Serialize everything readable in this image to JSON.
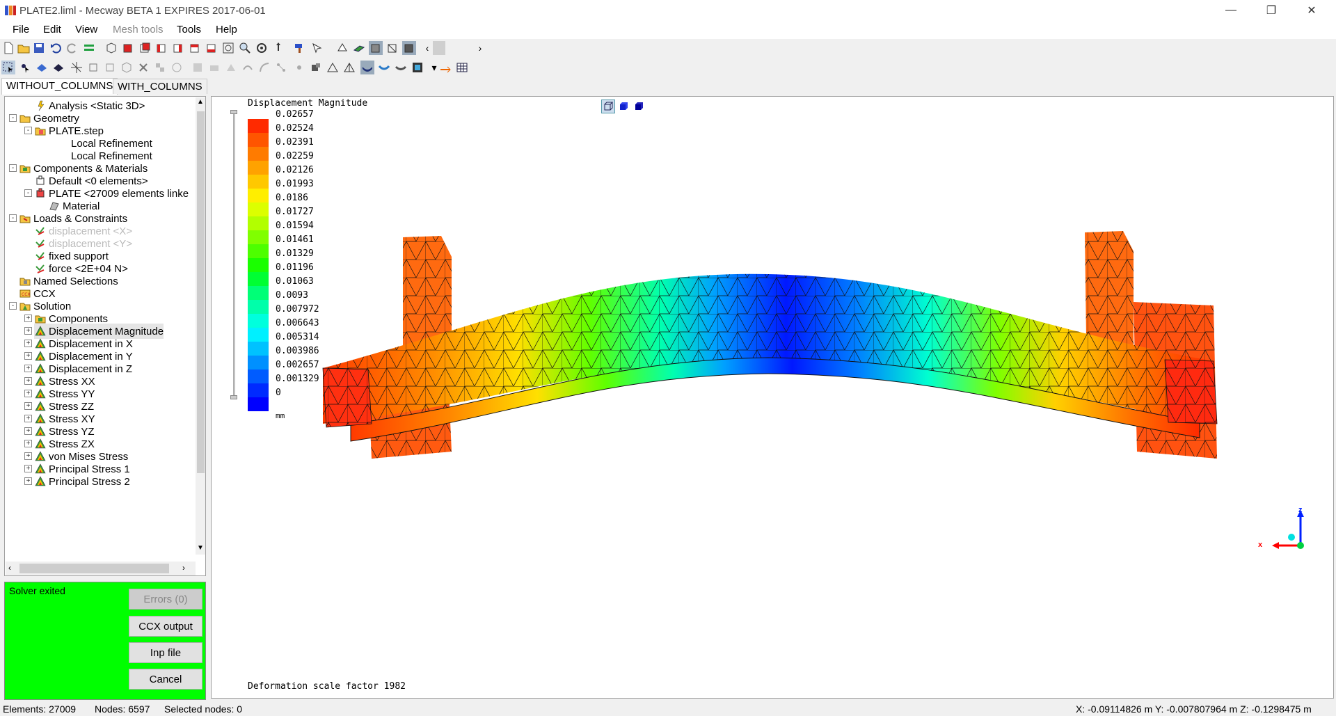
{
  "window": {
    "title": "PLATE2.liml - Mecway BETA 1 EXPIRES 2017-06-01",
    "minimize": "—",
    "maximize": "❐",
    "close": "✕"
  },
  "menu": [
    "File",
    "Edit",
    "View",
    "Mesh tools",
    "Tools",
    "Help"
  ],
  "tabs": [
    "WITHOUT_COLUMNS",
    "WITH_COLUMNS"
  ],
  "tree": {
    "items": [
      {
        "label": "Analysis <Static 3D>",
        "icon": "analysis-icon"
      },
      {
        "label": "Geometry",
        "icon": "folder-icon"
      },
      {
        "label": "PLATE.step",
        "icon": "step-file-icon"
      },
      {
        "label": "Local Refinement",
        "icon": ""
      },
      {
        "label": "Local Refinement",
        "icon": ""
      },
      {
        "label": "Components & Materials",
        "icon": "components-icon"
      },
      {
        "label": "Default <0 elements>",
        "icon": "component-icon"
      },
      {
        "label": "PLATE <27009 elements linke",
        "icon": "component-red-icon"
      },
      {
        "label": "Material",
        "icon": "material-icon"
      },
      {
        "label": "Loads & Constraints",
        "icon": "loads-folder-icon"
      },
      {
        "label": "displacement <X>",
        "icon": "constraint-icon"
      },
      {
        "label": "displacement <Y>",
        "icon": "constraint-icon"
      },
      {
        "label": "fixed support",
        "icon": "constraint-icon"
      },
      {
        "label": "force <2E+04 N>",
        "icon": "force-icon"
      },
      {
        "label": "Named Selections",
        "icon": "named-selections-icon"
      },
      {
        "label": "CCX",
        "icon": "ccx-icon"
      },
      {
        "label": "Solution",
        "icon": "solution-icon"
      },
      {
        "label": "Components",
        "icon": "components-icon"
      },
      {
        "label": "Displacement Magnitude",
        "icon": "result-icon"
      },
      {
        "label": "Displacement in X",
        "icon": "result-icon"
      },
      {
        "label": "Displacement in Y",
        "icon": "result-icon"
      },
      {
        "label": "Displacement in Z",
        "icon": "result-icon"
      },
      {
        "label": "Stress XX",
        "icon": "result-icon"
      },
      {
        "label": "Stress YY",
        "icon": "result-icon"
      },
      {
        "label": "Stress ZZ",
        "icon": "result-icon"
      },
      {
        "label": "Stress XY",
        "icon": "result-icon"
      },
      {
        "label": "Stress YZ",
        "icon": "result-icon"
      },
      {
        "label": "Stress ZX",
        "icon": "result-icon"
      },
      {
        "label": "von Mises Stress",
        "icon": "result-icon"
      },
      {
        "label": "Principal Stress 1",
        "icon": "result-icon"
      },
      {
        "label": "Principal Stress 2",
        "icon": "result-icon"
      }
    ]
  },
  "solver": {
    "status": "Solver exited",
    "errors_label": "Errors (0)",
    "ccx_output_label": "CCX output",
    "inp_file_label": "Inp file",
    "cancel_label": "Cancel",
    "background_color": "#00ff00"
  },
  "viewport": {
    "legend_title": "Displacement Magnitude",
    "legend_values": [
      "0.02657",
      "0.02524",
      "0.02391",
      "0.02259",
      "0.02126",
      "0.01993",
      "0.0186",
      "0.01727",
      "0.01594",
      "0.01461",
      "0.01329",
      "0.01196",
      "0.01063",
      "0.0093",
      "0.007972",
      "0.006643",
      "0.005314",
      "0.003986",
      "0.002657",
      "0.001329",
      "0"
    ],
    "legend_colors": [
      "#ff2a00",
      "#ff5500",
      "#ff7b00",
      "#ffa200",
      "#ffc800",
      "#ffee00",
      "#dcff00",
      "#b2ff00",
      "#80ff00",
      "#4dff00",
      "#1aff00",
      "#00ff33",
      "#00ff77",
      "#00ffaa",
      "#00ffdd",
      "#00f0ff",
      "#00c2ff",
      "#0090ff",
      "#005cff",
      "#002aff",
      "#0000ff"
    ],
    "units": "mm",
    "scale_text": "Deformation scale factor 1982",
    "axis_z": "z",
    "axis_x": "x"
  },
  "statusbar": {
    "elements": "Elements: 27009",
    "nodes": "Nodes: 6597",
    "selected": "Selected nodes: 0",
    "coords": "X: -0.09114826 m Y: -0.007807964 m Z: -0.1298475 m"
  }
}
